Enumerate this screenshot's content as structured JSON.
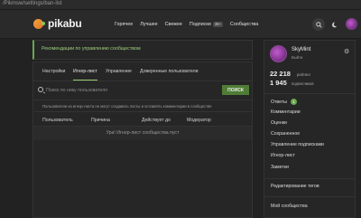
{
  "browser": {
    "url": "/Pikmsw/settings/ban-list"
  },
  "header": {
    "logo_text": "pikabu",
    "nav": [
      {
        "label": "Горячее"
      },
      {
        "label": "Лучшее"
      },
      {
        "label": "Свежее"
      },
      {
        "label": "Подписки",
        "badge": "36+"
      },
      {
        "label": "Сообщества"
      }
    ],
    "icons": [
      "search-icon",
      "moon-icon",
      "bell-icon",
      "avatar"
    ]
  },
  "notice": {
    "text": "Рекомендации по управлению сообществом"
  },
  "tabs": [
    {
      "label": "Настройки"
    },
    {
      "label": "Игнор-лист",
      "active": true
    },
    {
      "label": "Управление"
    },
    {
      "label": "Доверенные пользователи"
    }
  ],
  "search": {
    "placeholder": "Поиск по нику пользователя",
    "button_label": "ПОИСК"
  },
  "hint": {
    "text": "Пользователи из игнор-листа не могут создавать посты и оставлять комментарии в сообществе"
  },
  "table": {
    "columns": [
      "Пользователь",
      "Причина",
      "Действует до",
      "Модератор"
    ],
    "empty_text": "Ура! Игнор-лист сообщества пуст"
  },
  "sidebar": {
    "username": "SkyMint",
    "logout": "Выйти",
    "rating_value": "22 218",
    "rating_label": "рейтинг",
    "subscribers_value": "1 945",
    "subscribers_label": "подписчиков",
    "menu": [
      {
        "label": "Ответы",
        "count": "1"
      },
      {
        "label": "Комментарии"
      },
      {
        "label": "Оценки"
      },
      {
        "label": "Сохраненное"
      },
      {
        "label": "Управление подписками"
      },
      {
        "label": "Игнор-лист"
      },
      {
        "label": "Заметки"
      }
    ],
    "edit_label": "Редактирование тегов",
    "community_label": "Мой сообщества"
  },
  "colors": {
    "accent": "#6aa84f",
    "button": "#4f7d36",
    "bg": "#222223"
  }
}
